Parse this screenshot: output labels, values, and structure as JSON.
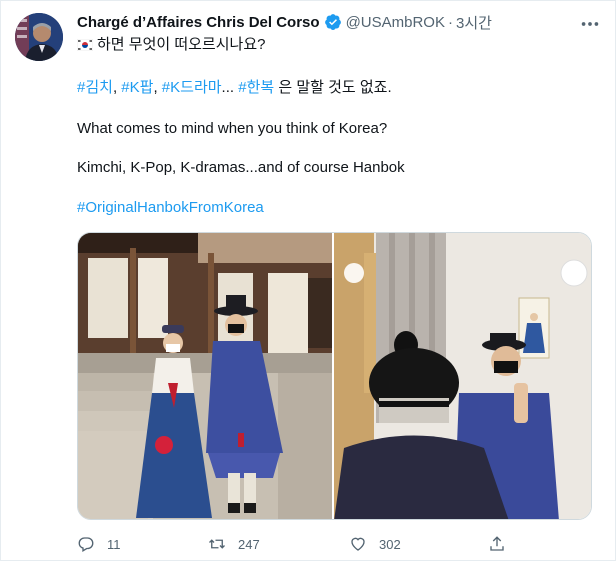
{
  "tweet": {
    "author": {
      "display_name": "Chargé d’Affaires Chris Del Corso",
      "handle": "@USAmbROK",
      "separator": "·",
      "time": "3시간",
      "verified": true
    },
    "text": {
      "line1": "하면 무엇이 떠오르시나요?",
      "tags": [
        "#김치",
        "#K팝",
        "#K드라마"
      ],
      "tag_sep1": ",",
      "tag_sep2": ",",
      "ellipsis": "...",
      "tag_last": "#한복",
      "line2_tail": " 은 말할 것도 없죠.",
      "paragraph2": "What comes to mind when you think of Korea?",
      "paragraph3": "Kimchi, K-Pop, K-dramas...and of course Hanbok",
      "paragraph4": "#OriginalHanbokFromKorea"
    },
    "media": {
      "photos": [
        {
          "description_icon": "photo-hanbok-couple"
        },
        {
          "description_icon": "photo-mirror-selfie"
        }
      ]
    },
    "stats": {
      "replies": "11",
      "retweets": "247",
      "likes": "302"
    },
    "icons": {
      "reply": "reply-icon",
      "retweet": "retweet-icon",
      "like": "heart-icon",
      "share": "share-icon",
      "more": "more-icon",
      "verified": "verified-badge-icon",
      "flag": "korea-flag-icon"
    },
    "colors": {
      "link": "#1d9bf0",
      "muted": "#536471",
      "text": "#0f1419"
    }
  }
}
